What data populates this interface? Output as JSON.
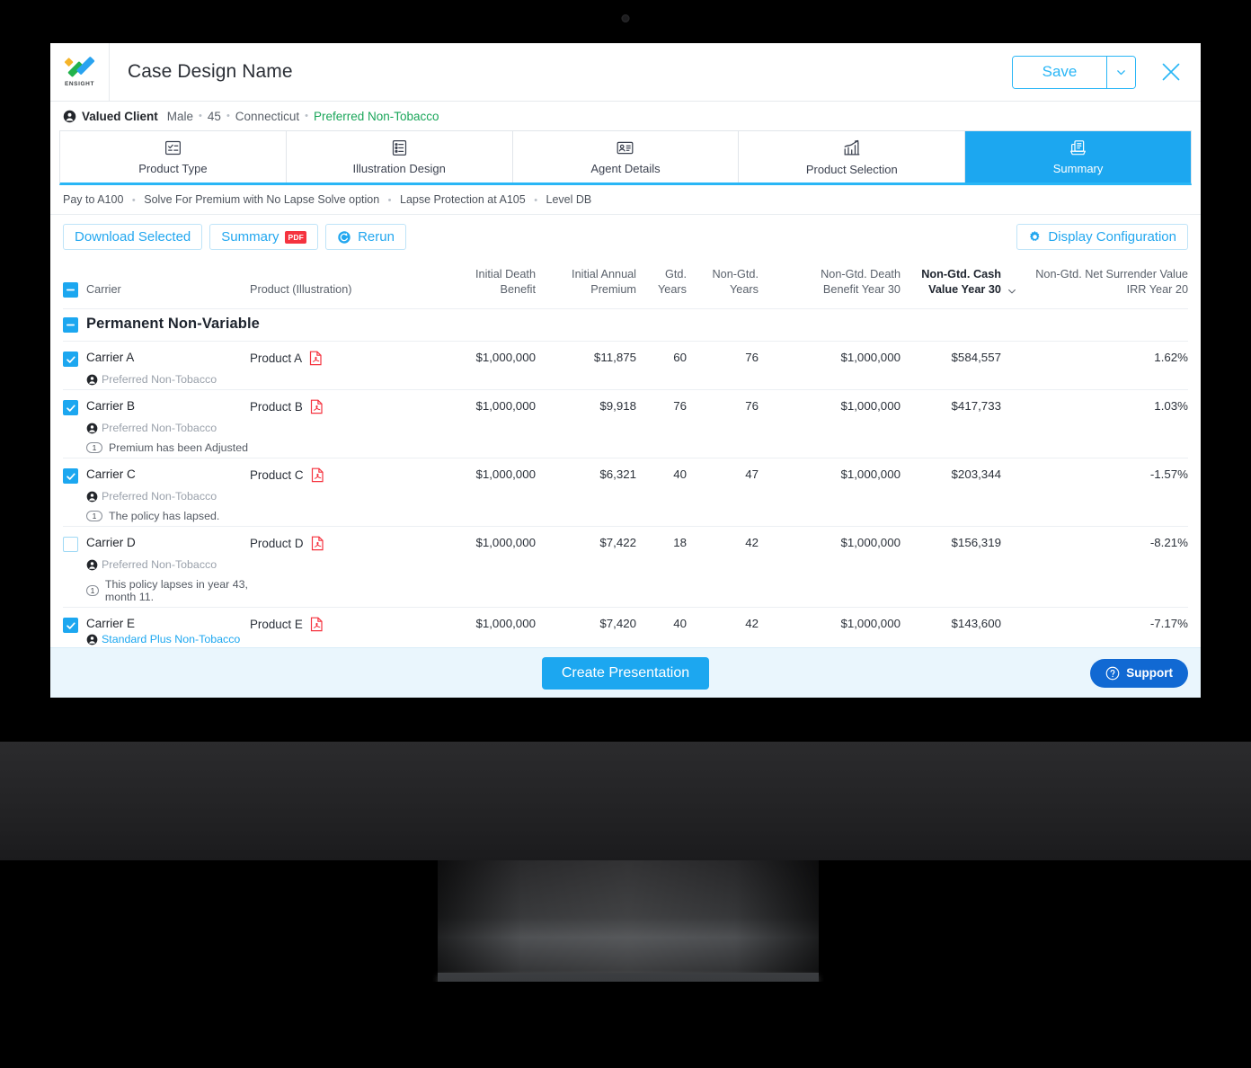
{
  "brand": {
    "name": "ENSIGHT",
    "logo_colors": [
      "#f5b429",
      "#22b24c",
      "#29a3f0"
    ]
  },
  "header": {
    "title": "Case Design Name",
    "save_label": "Save",
    "save_caret_icon": "chevron-down-icon",
    "close_icon": "close-icon"
  },
  "client": {
    "icon": "person-icon",
    "name": "Valued Client",
    "gender": "Male",
    "age": "45",
    "state": "Connecticut",
    "risk_class": "Preferred Non-Tobacco",
    "risk_class_color": "#1aa65a",
    "separator": "•"
  },
  "tabs": [
    {
      "label": "Product Type",
      "icon": "checklist-icon",
      "active": false
    },
    {
      "label": "Illustration Design",
      "icon": "form-list-icon",
      "active": false
    },
    {
      "label": "Agent Details",
      "icon": "id-card-icon",
      "active": false
    },
    {
      "label": "Product Selection",
      "icon": "bar-chart-icon",
      "active": false
    },
    {
      "label": "Summary",
      "icon": "presentation-icon",
      "active": true
    }
  ],
  "config_bar": {
    "items": [
      "Pay to A100",
      "Solve For Premium with No Lapse Solve option",
      "Lapse Protection at A105",
      "Level DB"
    ],
    "separator": "•"
  },
  "toolbar": {
    "download_label": "Download Selected",
    "summary_label": "Summary",
    "summary_badge": "PDF",
    "rerun_label": "Rerun",
    "rerun_icon": "refresh-icon",
    "display_config_label": "Display Configuration",
    "display_config_icon": "gear-icon"
  },
  "table": {
    "headers": {
      "carrier": "Carrier",
      "product": "Product (Illustration)",
      "initial_death_benefit": "Initial Death\nBenefit",
      "initial_annual_premium": "Initial Annual\nPremium",
      "gtd_years": "Gtd.\nYears",
      "non_gtd_years": "Non-Gtd.\nYears",
      "non_gtd_death_benefit": "Non-Gtd. Death\nBenefit Year 30",
      "non_gtd_cash_value": "Non-Gtd. Cash\nValue Year 30",
      "non_gtd_irr": "Non-Gtd. Net Surrender Value\nIRR Year 20"
    },
    "sorted_column": "non_gtd_cash_value",
    "sort_icon": "chevron-down-icon",
    "group": {
      "label": "Permanent Non-Variable",
      "checkbox_state": "indeterminate"
    },
    "header_checkbox_state": "indeterminate",
    "rows": [
      {
        "checked": true,
        "carrier": "Carrier A",
        "product": "Product A",
        "pdf_icon": "pdf-file-icon",
        "risk_class": "Preferred Non-Tobacco",
        "risk_class_style": "muted",
        "note": null,
        "note_number": null,
        "initial_death_benefit": "$1,000,000",
        "initial_annual_premium": "$11,875",
        "gtd_years": "60",
        "non_gtd_years": "76",
        "non_gtd_death_benefit": "$1,000,000",
        "non_gtd_cash_value": "$584,557",
        "non_gtd_irr": "1.62%"
      },
      {
        "checked": true,
        "carrier": "Carrier B",
        "product": "Product B",
        "pdf_icon": "pdf-file-icon",
        "risk_class": "Preferred Non-Tobacco",
        "risk_class_style": "muted",
        "note": "Premium has been Adjusted",
        "note_number": "1",
        "initial_death_benefit": "$1,000,000",
        "initial_annual_premium": "$9,918",
        "gtd_years": "76",
        "non_gtd_years": "76",
        "non_gtd_death_benefit": "$1,000,000",
        "non_gtd_cash_value": "$417,733",
        "non_gtd_irr": "1.03%"
      },
      {
        "checked": true,
        "carrier": "Carrier C",
        "product": "Product C",
        "pdf_icon": "pdf-file-icon",
        "risk_class": "Preferred Non-Tobacco",
        "risk_class_style": "muted",
        "note": "The policy has lapsed.",
        "note_number": "1",
        "initial_death_benefit": "$1,000,000",
        "initial_annual_premium": "$6,321",
        "gtd_years": "40",
        "non_gtd_years": "47",
        "non_gtd_death_benefit": "$1,000,000",
        "non_gtd_cash_value": "$203,344",
        "non_gtd_irr": "-1.57%"
      },
      {
        "checked": false,
        "carrier": "Carrier D",
        "product": "Product D",
        "pdf_icon": "pdf-file-icon",
        "risk_class": "Preferred Non-Tobacco",
        "risk_class_style": "muted",
        "note": "This policy lapses in year 43, month 11.",
        "note_number": "1",
        "initial_death_benefit": "$1,000,000",
        "initial_annual_premium": "$7,422",
        "gtd_years": "18",
        "non_gtd_years": "42",
        "non_gtd_death_benefit": "$1,000,000",
        "non_gtd_cash_value": "$156,319",
        "non_gtd_irr": "-8.21%"
      },
      {
        "checked": true,
        "carrier": "Carrier E",
        "product": "Product E",
        "pdf_icon": "pdf-file-icon",
        "risk_class": "Standard Plus Non-Tobacco",
        "risk_class_style": "link",
        "note": null,
        "note_number": null,
        "initial_death_benefit": "$1,000,000",
        "initial_annual_premium": "$7,420",
        "gtd_years": "40",
        "non_gtd_years": "42",
        "non_gtd_death_benefit": "$1,000,000",
        "non_gtd_cash_value": "$143,600",
        "non_gtd_irr": "-7.17%"
      }
    ]
  },
  "footer": {
    "cta_label": "Create Presentation",
    "support_label": "Support",
    "support_icon": "question-circle-icon"
  },
  "colors": {
    "accent": "#1ca7f0",
    "accent_light": "#29b6f6",
    "pdf_red": "#f5333f",
    "support_blue": "#1169d3",
    "green": "#1aa65a"
  }
}
